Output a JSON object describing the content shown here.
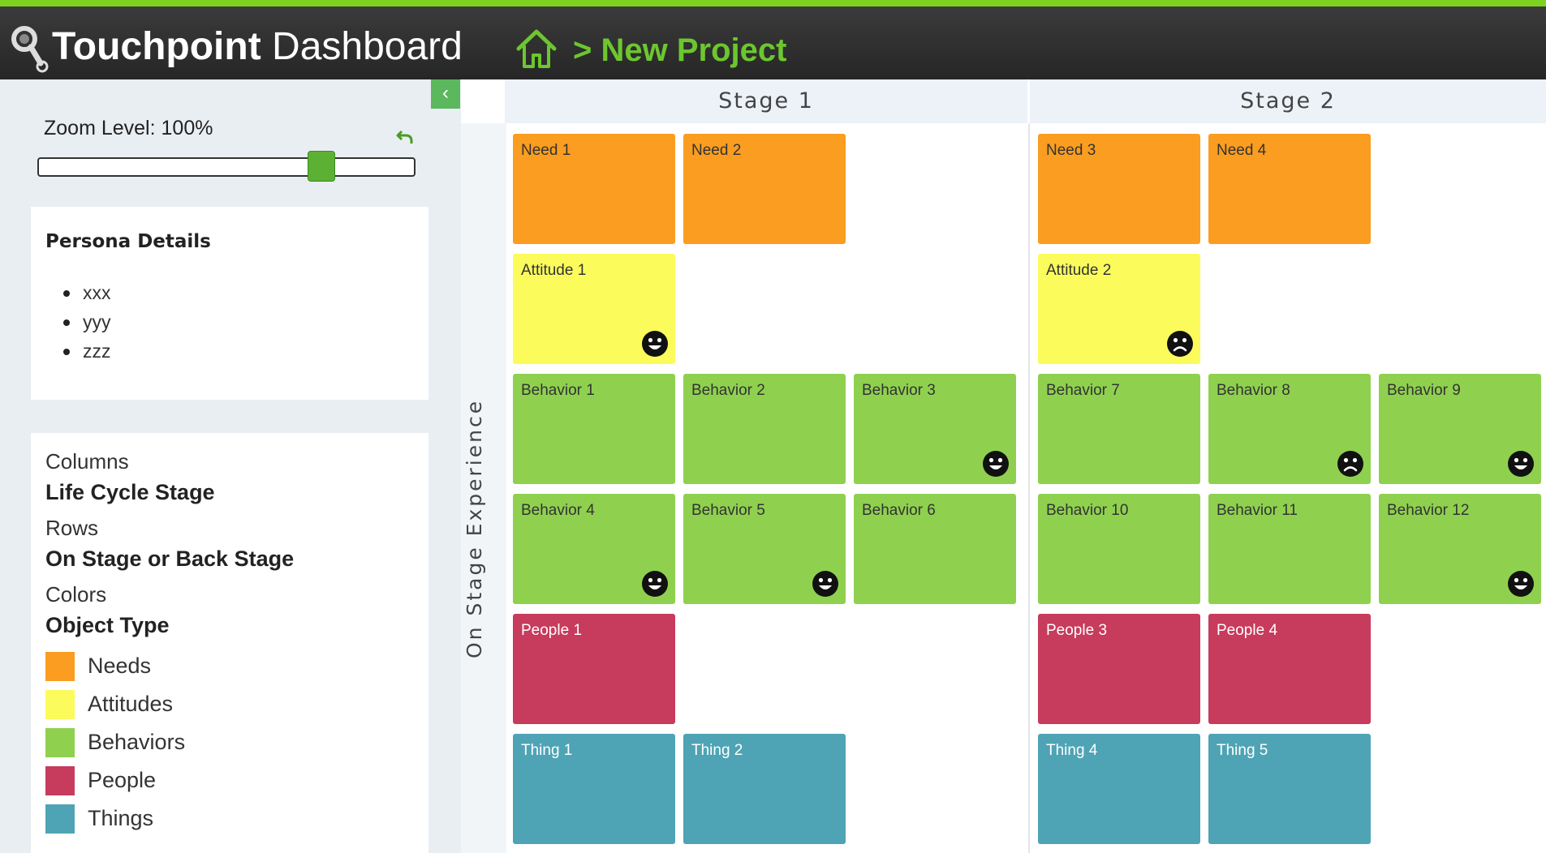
{
  "header": {
    "brand_bold": "Touchpoint",
    "brand_light": " Dashboard",
    "breadcrumb": "> New Project"
  },
  "zoom": {
    "label": "Zoom Level: 100%",
    "slider_position": 0.75
  },
  "persona": {
    "title": "Persona Details",
    "items": [
      "xxx",
      "yyy",
      "zzz"
    ]
  },
  "legend": {
    "columns_label": "Columns",
    "columns_value": "Life Cycle Stage",
    "rows_label": "Rows",
    "rows_value": "On Stage or Back Stage",
    "colors_label": "Colors",
    "colors_value": "Object Type",
    "swatches": [
      {
        "label": "Needs",
        "color": "#fa9d20"
      },
      {
        "label": "Attitudes",
        "color": "#fbfb5c"
      },
      {
        "label": "Behaviors",
        "color": "#8fd14f"
      },
      {
        "label": "People",
        "color": "#c73b5c"
      },
      {
        "label": "Things",
        "color": "#4ea4b5"
      }
    ]
  },
  "board": {
    "row_label": "On Stage Experience",
    "stages": [
      {
        "name": "Stage 1",
        "rows": [
          [
            {
              "label": "Need 1",
              "type": "needs"
            },
            {
              "label": "Need 2",
              "type": "needs"
            }
          ],
          [
            {
              "label": "Attitude 1",
              "type": "attitudes",
              "face": "happy"
            }
          ],
          [
            {
              "label": "Behavior 1",
              "type": "behaviors"
            },
            {
              "label": "Behavior 2",
              "type": "behaviors"
            },
            {
              "label": "Behavior 3",
              "type": "behaviors",
              "face": "happy"
            }
          ],
          [
            {
              "label": "Behavior 4",
              "type": "behaviors",
              "face": "happy"
            },
            {
              "label": "Behavior 5",
              "type": "behaviors",
              "face": "happy"
            },
            {
              "label": "Behavior 6",
              "type": "behaviors"
            }
          ],
          [
            {
              "label": "People 1",
              "type": "people"
            }
          ],
          [
            {
              "label": "Thing 1",
              "type": "things"
            },
            {
              "label": "Thing 2",
              "type": "things"
            }
          ]
        ]
      },
      {
        "name": "Stage 2",
        "rows": [
          [
            {
              "label": "Need 3",
              "type": "needs"
            },
            {
              "label": "Need 4",
              "type": "needs"
            }
          ],
          [
            {
              "label": "Attitude 2",
              "type": "attitudes",
              "face": "sad"
            }
          ],
          [
            {
              "label": "Behavior 7",
              "type": "behaviors"
            },
            {
              "label": "Behavior 8",
              "type": "behaviors",
              "face": "sad"
            },
            {
              "label": "Behavior 9",
              "type": "behaviors",
              "face": "happy"
            }
          ],
          [
            {
              "label": "Behavior 10",
              "type": "behaviors"
            },
            {
              "label": "Behavior 11",
              "type": "behaviors"
            },
            {
              "label": "Behavior 12",
              "type": "behaviors",
              "face": "happy"
            }
          ],
          [
            {
              "label": "People 3",
              "type": "people"
            },
            {
              "label": "People 4",
              "type": "people"
            }
          ],
          [
            {
              "label": "Thing 4",
              "type": "things"
            },
            {
              "label": "Thing 5",
              "type": "things"
            }
          ]
        ]
      }
    ]
  }
}
